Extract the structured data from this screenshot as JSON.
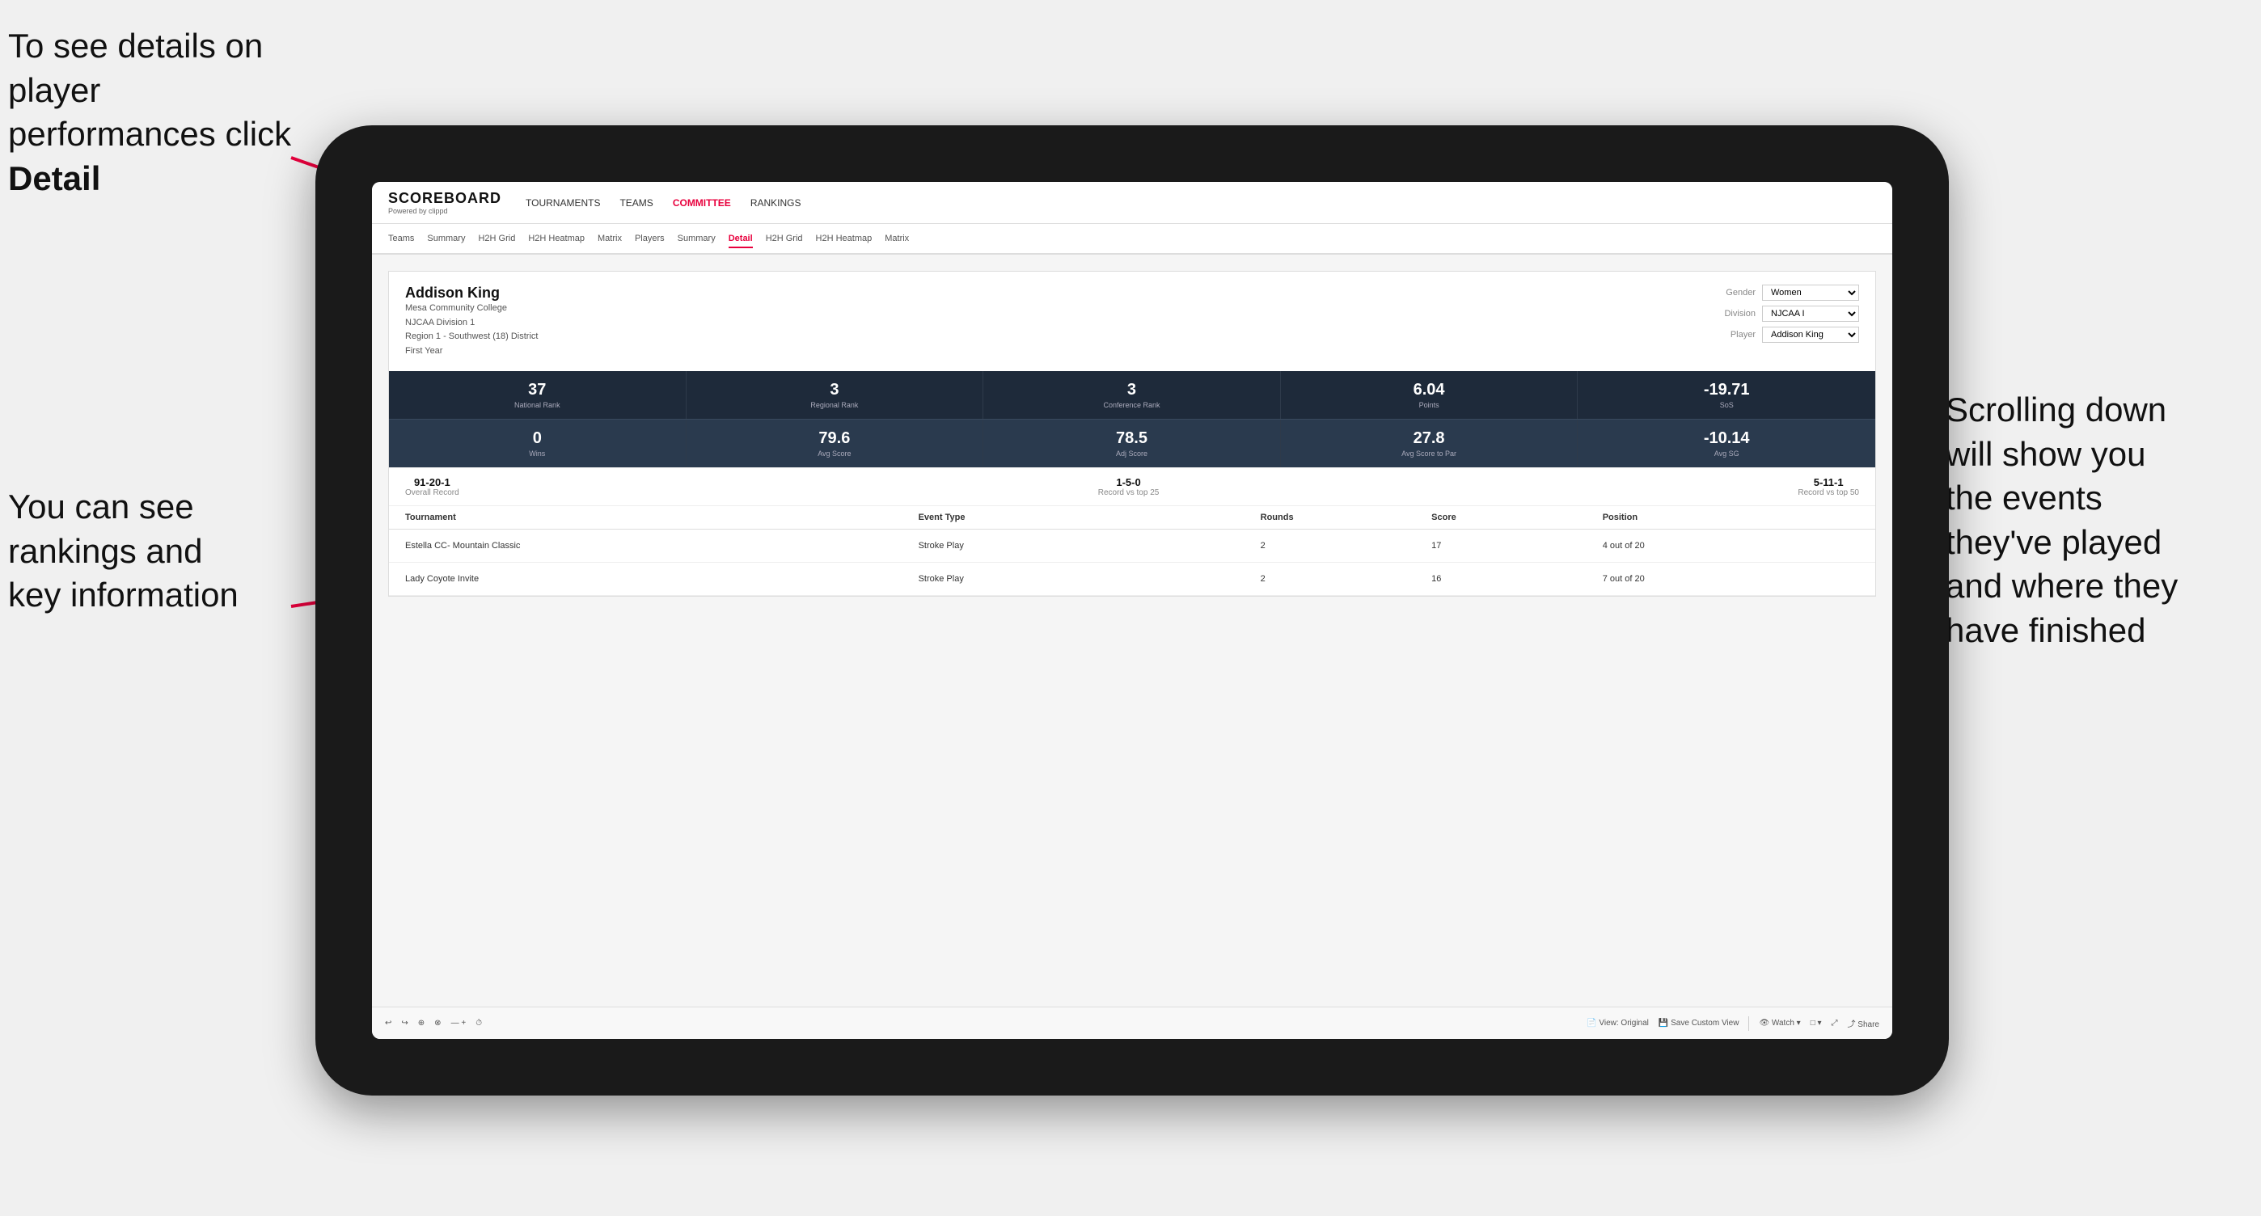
{
  "annotations": {
    "top_left": "To see details on player performances click ",
    "top_left_bold": "Detail",
    "bottom_left_line1": "You can see",
    "bottom_left_line2": "rankings and",
    "bottom_left_line3": "key information",
    "right_line1": "Scrolling down",
    "right_line2": "will show you",
    "right_line3": "the events",
    "right_line4": "they've played",
    "right_line5": "and where they",
    "right_line6": "have finished"
  },
  "nav": {
    "logo": "SCOREBOARD",
    "logo_sub": "Powered by clippd",
    "items": [
      "TOURNAMENTS",
      "TEAMS",
      "COMMITTEE",
      "RANKINGS"
    ]
  },
  "subnav": {
    "items": [
      "Teams",
      "Summary",
      "H2H Grid",
      "H2H Heatmap",
      "Matrix",
      "Players",
      "Summary",
      "Detail",
      "H2H Grid",
      "H2H Heatmap",
      "Matrix"
    ],
    "active": "Detail"
  },
  "player": {
    "name": "Addison King",
    "school": "Mesa Community College",
    "division": "NJCAA Division 1",
    "region": "Region 1 - Southwest (18) District",
    "year": "First Year",
    "gender_label": "Gender",
    "gender_value": "Women",
    "division_label": "Division",
    "division_value": "NJCAA I",
    "player_label": "Player",
    "player_value": "Addison King"
  },
  "stats_row1": [
    {
      "value": "37",
      "label": "National Rank"
    },
    {
      "value": "3",
      "label": "Regional Rank"
    },
    {
      "value": "3",
      "label": "Conference Rank"
    },
    {
      "value": "6.04",
      "label": "Points"
    },
    {
      "value": "-19.71",
      "label": "SoS"
    }
  ],
  "stats_row2": [
    {
      "value": "0",
      "label": "Wins"
    },
    {
      "value": "79.6",
      "label": "Avg Score"
    },
    {
      "value": "78.5",
      "label": "Adj Score"
    },
    {
      "value": "27.8",
      "label": "Avg Score to Par"
    },
    {
      "value": "-10.14",
      "label": "Avg SG"
    }
  ],
  "records": [
    {
      "value": "91-20-1",
      "label": "Overall Record"
    },
    {
      "value": "1-5-0",
      "label": "Record vs top 25"
    },
    {
      "value": "5-11-1",
      "label": "Record vs top 50"
    }
  ],
  "table": {
    "headers": [
      "Tournament",
      "Event Type",
      "Rounds",
      "Score",
      "Position"
    ],
    "rows": [
      {
        "tournament": "Estella CC- Mountain Classic",
        "event_type": "Stroke Play",
        "rounds": "2",
        "score": "17",
        "position": "4 out of 20"
      },
      {
        "tournament": "Lady Coyote Invite",
        "event_type": "Stroke Play",
        "rounds": "2",
        "score": "16",
        "position": "7 out of 20"
      }
    ]
  },
  "toolbar": {
    "items": [
      "↩",
      "↪",
      "⊕",
      "⊗",
      "— +",
      "⏱",
      "View: Original",
      "Save Custom View",
      "Watch ▾",
      "□ ▾",
      "⤢",
      "Share"
    ]
  }
}
